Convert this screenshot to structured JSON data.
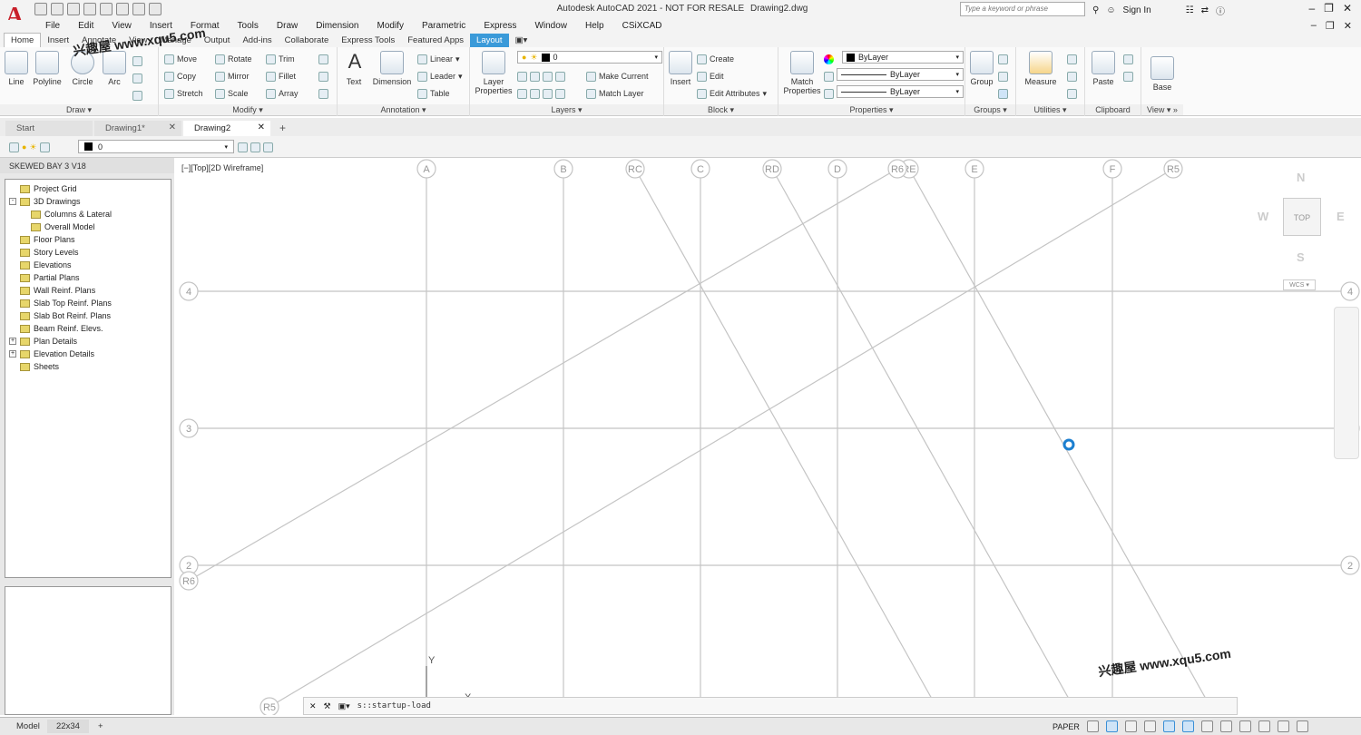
{
  "title_bar": {
    "app_name": "Autodesk AutoCAD 2021 - NOT FOR RESALE",
    "file_name": "Drawing2.dwg",
    "search_placeholder": "Type a keyword or phrase",
    "sign_in": "Sign In"
  },
  "menu": [
    "File",
    "Edit",
    "View",
    "Insert",
    "Format",
    "Tools",
    "Draw",
    "Dimension",
    "Modify",
    "Parametric",
    "Express",
    "Window",
    "Help",
    "CSiXCAD"
  ],
  "ribbon_tabs": [
    "Home",
    "Insert",
    "Annotate",
    "View",
    "Manage",
    "Output",
    "Add-ins",
    "Collaborate",
    "Express Tools",
    "Featured Apps",
    "Layout"
  ],
  "ribbon": {
    "draw": {
      "title": "Draw",
      "tools": [
        "Line",
        "Polyline",
        "Circle",
        "Arc"
      ]
    },
    "modify": {
      "title": "Modify",
      "tools": [
        "Move",
        "Rotate",
        "Trim",
        "Copy",
        "Mirror",
        "Fillet",
        "Stretch",
        "Scale",
        "Array"
      ]
    },
    "annotation": {
      "title": "Annotation",
      "tools": [
        "Text",
        "Dimension"
      ],
      "small": [
        "Linear",
        "Leader",
        "Table"
      ]
    },
    "layers": {
      "title": "Layers",
      "big": "Layer Properties",
      "layer_value": "0",
      "small": [
        "Make Current",
        "Match Layer"
      ]
    },
    "block": {
      "title": "Block",
      "big": "Insert",
      "small": [
        "Create",
        "Edit",
        "Edit Attributes"
      ]
    },
    "properties": {
      "title": "Properties",
      "big": "Match Properties",
      "color": "ByLayer",
      "linetype": "ByLayer",
      "lineweight": "ByLayer"
    },
    "groups": {
      "title": "Groups",
      "big": "Group"
    },
    "utilities": {
      "title": "Utilities",
      "big": "Measure"
    },
    "clipboard": {
      "title": "Clipboard",
      "big": "Paste"
    },
    "view": {
      "title": "View",
      "big": "Base"
    }
  },
  "file_tabs": [
    {
      "label": "Start"
    },
    {
      "label": "Drawing1*"
    },
    {
      "label": "Drawing2"
    }
  ],
  "layer_bar": {
    "layer_value": "0"
  },
  "project": {
    "header": "SKEWED BAY 3 V18",
    "tree": [
      {
        "label": "Project Grid",
        "indent": 1,
        "expander": ""
      },
      {
        "label": "3D Drawings",
        "indent": 0,
        "expander": "-"
      },
      {
        "label": "Columns & Lateral",
        "indent": 2,
        "expander": ""
      },
      {
        "label": "Overall Model",
        "indent": 2,
        "expander": ""
      },
      {
        "label": "Floor Plans",
        "indent": 1,
        "expander": ""
      },
      {
        "label": "Story Levels",
        "indent": 1,
        "expander": ""
      },
      {
        "label": "Elevations",
        "indent": 1,
        "expander": ""
      },
      {
        "label": "Partial Plans",
        "indent": 1,
        "expander": ""
      },
      {
        "label": "Wall Reinf. Plans",
        "indent": 1,
        "expander": ""
      },
      {
        "label": "Slab Top Reinf. Plans",
        "indent": 1,
        "expander": ""
      },
      {
        "label": "Slab Bot Reinf. Plans",
        "indent": 1,
        "expander": ""
      },
      {
        "label": "Beam Reinf. Elevs.",
        "indent": 1,
        "expander": ""
      },
      {
        "label": "Plan Details",
        "indent": 0,
        "expander": "+"
      },
      {
        "label": "Elevation Details",
        "indent": 0,
        "expander": "+"
      },
      {
        "label": "Sheets",
        "indent": 1,
        "expander": ""
      }
    ]
  },
  "viewport": {
    "label": "[−][Top][2D Wireframe]",
    "vertical_grid": [
      "A",
      "B",
      "C",
      "D",
      "E",
      "F"
    ],
    "horizontal_grid": [
      "4",
      "3",
      "2"
    ],
    "skew_a_labels": [
      "RC",
      "RD",
      "RE"
    ],
    "skew_b_labels": [
      "R5",
      "R6"
    ],
    "ucs_y": "Y",
    "ucs_x": "X",
    "viewcube": {
      "n": "N",
      "s": "S",
      "e": "E",
      "w": "W",
      "top": "TOP",
      "wcs": "WCS"
    }
  },
  "command_line": {
    "text": "s::startup-load"
  },
  "status": {
    "layout_tabs": [
      "Model",
      "22x34"
    ],
    "paper_label": "PAPER"
  },
  "watermark": "兴趣屋 www.xqu5.com",
  "colors": {
    "accent": "#3a9ad9",
    "logo": "#c8202a",
    "grid_line": "#c4c4c4",
    "cursor": "#1c7fd0"
  }
}
